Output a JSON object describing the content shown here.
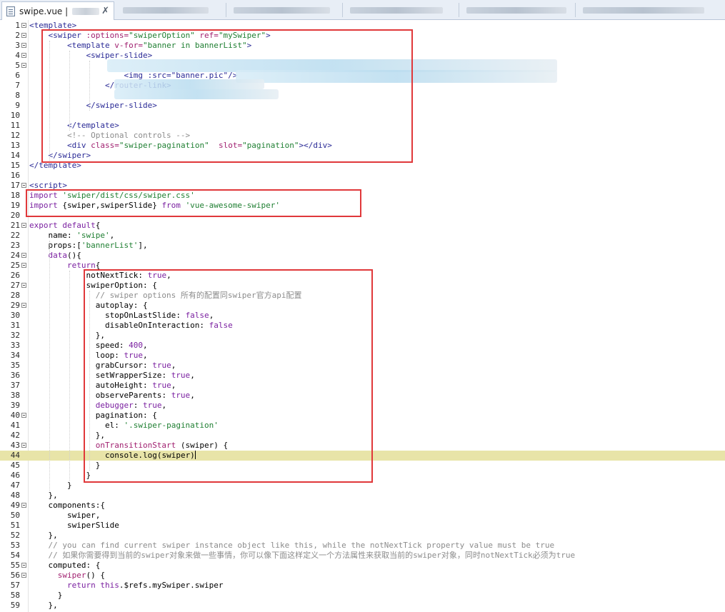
{
  "tab": {
    "filename": "swipe.vue |",
    "close": "✗"
  },
  "colors": {
    "tag": "#2a2a96",
    "attr": "#a01f6f",
    "string": "#1f7f32",
    "keyword": "#7a1fa0",
    "comment": "#8c8c8c",
    "literal": "#7a1fa0",
    "highlight_box": "#e0383a",
    "current_line": "#e8e4a8"
  },
  "lines": [
    {
      "n": "1",
      "fold": true,
      "indent": 0,
      "tokens": [
        {
          "t": "<template>",
          "c": "tag"
        }
      ]
    },
    {
      "n": "2",
      "fold": true,
      "indent": 4,
      "tokens": [
        {
          "t": "<swiper ",
          "c": "tag"
        },
        {
          "t": ":options=",
          "c": "attr"
        },
        {
          "t": "\"swiperOption\"",
          "c": "string"
        },
        {
          "t": " ref=",
          "c": "attr"
        },
        {
          "t": "\"mySwiper\"",
          "c": "string"
        },
        {
          "t": ">",
          "c": "tag"
        }
      ]
    },
    {
      "n": "3",
      "fold": true,
      "indent": 8,
      "tokens": [
        {
          "t": "<template ",
          "c": "tag"
        },
        {
          "t": "v-for=",
          "c": "attr"
        },
        {
          "t": "\"banner in bannerList\"",
          "c": "string"
        },
        {
          "t": ">",
          "c": "tag"
        }
      ]
    },
    {
      "n": "4",
      "fold": true,
      "indent": 12,
      "tokens": [
        {
          "t": "<swiper-slide>",
          "c": "tag"
        }
      ]
    },
    {
      "n": "5",
      "fold": true,
      "indent": 16,
      "tokens": []
    },
    {
      "n": "6",
      "fold": false,
      "indent": 20,
      "tokens": [
        {
          "t": "<img :src=\"banner.pic\"/>",
          "c": "tag"
        }
      ]
    },
    {
      "n": "7",
      "fold": false,
      "indent": 16,
      "tokens": [
        {
          "t": "</router-link>",
          "c": "tag"
        }
      ]
    },
    {
      "n": "8",
      "fold": false,
      "indent": 16,
      "tokens": []
    },
    {
      "n": "9",
      "fold": false,
      "indent": 12,
      "tokens": [
        {
          "t": "</swiper-slide>",
          "c": "tag"
        }
      ]
    },
    {
      "n": "10",
      "fold": false,
      "indent": 0,
      "tokens": []
    },
    {
      "n": "11",
      "fold": false,
      "indent": 8,
      "tokens": [
        {
          "t": "</template>",
          "c": "tag"
        }
      ]
    },
    {
      "n": "12",
      "fold": false,
      "indent": 8,
      "tokens": [
        {
          "t": "<!-- Optional controls -->",
          "c": "comment"
        }
      ]
    },
    {
      "n": "13",
      "fold": false,
      "indent": 8,
      "tokens": [
        {
          "t": "<div ",
          "c": "tag"
        },
        {
          "t": "class=",
          "c": "attr"
        },
        {
          "t": "\"swiper-pagination\"",
          "c": "string"
        },
        {
          "t": "  slot=",
          "c": "attr"
        },
        {
          "t": "\"pagination\"",
          "c": "string"
        },
        {
          "t": "></div>",
          "c": "tag"
        }
      ]
    },
    {
      "n": "14",
      "fold": false,
      "indent": 4,
      "tokens": [
        {
          "t": "</swiper>",
          "c": "tag"
        }
      ]
    },
    {
      "n": "15",
      "fold": false,
      "indent": 0,
      "tokens": [
        {
          "t": "</template>",
          "c": "tag"
        }
      ]
    },
    {
      "n": "16",
      "fold": false,
      "indent": 0,
      "tokens": []
    },
    {
      "n": "17",
      "fold": true,
      "indent": 0,
      "tokens": [
        {
          "t": "<script>",
          "c": "tag"
        }
      ]
    },
    {
      "n": "18",
      "fold": false,
      "indent": 0,
      "tokens": [
        {
          "t": "import ",
          "c": "keyword"
        },
        {
          "t": "'swiper/dist/css/swiper.css'",
          "c": "string"
        }
      ]
    },
    {
      "n": "19",
      "fold": false,
      "indent": 0,
      "tokens": [
        {
          "t": "import ",
          "c": "keyword"
        },
        {
          "t": "{swiper,swiperSlide} ",
          "c": "plain"
        },
        {
          "t": "from ",
          "c": "keyword"
        },
        {
          "t": "'vue-awesome-swiper'",
          "c": "string"
        }
      ]
    },
    {
      "n": "20",
      "fold": false,
      "indent": 0,
      "tokens": []
    },
    {
      "n": "21",
      "fold": true,
      "indent": 0,
      "tokens": [
        {
          "t": "export default",
          "c": "keyword"
        },
        {
          "t": "{",
          "c": "plain"
        }
      ]
    },
    {
      "n": "22",
      "fold": false,
      "indent": 4,
      "tokens": [
        {
          "t": "name",
          "c": "plain"
        },
        {
          "t": ": ",
          "c": "plain"
        },
        {
          "t": "'swipe'",
          "c": "string"
        },
        {
          "t": ",",
          "c": "plain"
        }
      ]
    },
    {
      "n": "23",
      "fold": false,
      "indent": 4,
      "tokens": [
        {
          "t": "props",
          "c": "plain"
        },
        {
          "t": ":[",
          "c": "plain"
        },
        {
          "t": "'bannerList'",
          "c": "string"
        },
        {
          "t": "],",
          "c": "plain"
        }
      ]
    },
    {
      "n": "24",
      "fold": true,
      "indent": 4,
      "tokens": [
        {
          "t": "data",
          "c": "keyword"
        },
        {
          "t": "(){",
          "c": "plain"
        }
      ]
    },
    {
      "n": "25",
      "fold": true,
      "indent": 8,
      "tokens": [
        {
          "t": "return",
          "c": "keyword"
        },
        {
          "t": "{",
          "c": "plain"
        }
      ]
    },
    {
      "n": "26",
      "fold": false,
      "indent": 12,
      "tokens": [
        {
          "t": "notNextTick",
          "c": "plain"
        },
        {
          "t": ": ",
          "c": "plain"
        },
        {
          "t": "true",
          "c": "literal"
        },
        {
          "t": ",",
          "c": "plain"
        }
      ]
    },
    {
      "n": "27",
      "fold": true,
      "indent": 12,
      "tokens": [
        {
          "t": "swiperOption",
          "c": "plain"
        },
        {
          "t": ": {",
          "c": "plain"
        }
      ]
    },
    {
      "n": "28",
      "fold": false,
      "indent": 14,
      "tokens": [
        {
          "t": "// swiper options 所有的配置同swiper官方api配置",
          "c": "comment"
        }
      ]
    },
    {
      "n": "29",
      "fold": true,
      "indent": 14,
      "tokens": [
        {
          "t": "autoplay",
          "c": "plain"
        },
        {
          "t": ": {",
          "c": "plain"
        }
      ]
    },
    {
      "n": "30",
      "fold": false,
      "indent": 16,
      "tokens": [
        {
          "t": "stopOnLastSlide",
          "c": "plain"
        },
        {
          "t": ": ",
          "c": "plain"
        },
        {
          "t": "false",
          "c": "literal"
        },
        {
          "t": ",",
          "c": "plain"
        }
      ]
    },
    {
      "n": "31",
      "fold": false,
      "indent": 16,
      "tokens": [
        {
          "t": "disableOnInteraction",
          "c": "plain"
        },
        {
          "t": ": ",
          "c": "plain"
        },
        {
          "t": "false",
          "c": "literal"
        }
      ]
    },
    {
      "n": "32",
      "fold": false,
      "indent": 14,
      "tokens": [
        {
          "t": "},",
          "c": "plain"
        }
      ]
    },
    {
      "n": "33",
      "fold": false,
      "indent": 14,
      "tokens": [
        {
          "t": "speed",
          "c": "plain"
        },
        {
          "t": ": ",
          "c": "plain"
        },
        {
          "t": "400",
          "c": "literal"
        },
        {
          "t": ",",
          "c": "plain"
        }
      ]
    },
    {
      "n": "34",
      "fold": false,
      "indent": 14,
      "tokens": [
        {
          "t": "loop",
          "c": "plain"
        },
        {
          "t": ": ",
          "c": "plain"
        },
        {
          "t": "true",
          "c": "literal"
        },
        {
          "t": ",",
          "c": "plain"
        }
      ]
    },
    {
      "n": "35",
      "fold": false,
      "indent": 14,
      "tokens": [
        {
          "t": "grabCursor",
          "c": "plain"
        },
        {
          "t": ": ",
          "c": "plain"
        },
        {
          "t": "true",
          "c": "literal"
        },
        {
          "t": ",",
          "c": "plain"
        }
      ]
    },
    {
      "n": "36",
      "fold": false,
      "indent": 14,
      "tokens": [
        {
          "t": "setWrapperSize",
          "c": "plain"
        },
        {
          "t": ": ",
          "c": "plain"
        },
        {
          "t": "true",
          "c": "literal"
        },
        {
          "t": ",",
          "c": "plain"
        }
      ]
    },
    {
      "n": "37",
      "fold": false,
      "indent": 14,
      "tokens": [
        {
          "t": "autoHeight",
          "c": "plain"
        },
        {
          "t": ": ",
          "c": "plain"
        },
        {
          "t": "true",
          "c": "literal"
        },
        {
          "t": ",",
          "c": "plain"
        }
      ]
    },
    {
      "n": "38",
      "fold": false,
      "indent": 14,
      "tokens": [
        {
          "t": "observeParents",
          "c": "plain"
        },
        {
          "t": ": ",
          "c": "plain"
        },
        {
          "t": "true",
          "c": "literal"
        },
        {
          "t": ",",
          "c": "plain"
        }
      ]
    },
    {
      "n": "39",
      "fold": false,
      "indent": 14,
      "tokens": [
        {
          "t": "debugger",
          "c": "keyword"
        },
        {
          "t": ": ",
          "c": "plain"
        },
        {
          "t": "true",
          "c": "literal"
        },
        {
          "t": ",",
          "c": "plain"
        }
      ]
    },
    {
      "n": "40",
      "fold": true,
      "indent": 14,
      "tokens": [
        {
          "t": "pagination",
          "c": "plain"
        },
        {
          "t": ": {",
          "c": "plain"
        }
      ]
    },
    {
      "n": "41",
      "fold": false,
      "indent": 16,
      "tokens": [
        {
          "t": "el",
          "c": "plain"
        },
        {
          "t": ": ",
          "c": "plain"
        },
        {
          "t": "'.swiper-pagination'",
          "c": "string"
        }
      ]
    },
    {
      "n": "42",
      "fold": false,
      "indent": 14,
      "tokens": [
        {
          "t": "},",
          "c": "plain"
        }
      ]
    },
    {
      "n": "43",
      "fold": true,
      "indent": 14,
      "tokens": [
        {
          "t": "onTransitionStart",
          "c": "attr"
        },
        {
          "t": " (swiper) {",
          "c": "plain"
        }
      ]
    },
    {
      "n": "44",
      "fold": false,
      "indent": 16,
      "current": true,
      "tokens": [
        {
          "t": "console",
          "c": "plain"
        },
        {
          "t": ".",
          "c": "plain"
        },
        {
          "t": "log",
          "c": "plain"
        },
        {
          "t": "(swiper)",
          "c": "plain"
        }
      ]
    },
    {
      "n": "45",
      "fold": false,
      "indent": 14,
      "tokens": [
        {
          "t": "}",
          "c": "plain"
        }
      ]
    },
    {
      "n": "46",
      "fold": false,
      "indent": 12,
      "tokens": [
        {
          "t": "}",
          "c": "plain"
        }
      ]
    },
    {
      "n": "47",
      "fold": false,
      "indent": 8,
      "tokens": [
        {
          "t": "}",
          "c": "plain"
        }
      ]
    },
    {
      "n": "48",
      "fold": false,
      "indent": 4,
      "tokens": [
        {
          "t": "},",
          "c": "plain"
        }
      ]
    },
    {
      "n": "49",
      "fold": true,
      "indent": 4,
      "tokens": [
        {
          "t": "components",
          "c": "plain"
        },
        {
          "t": ":{",
          "c": "plain"
        }
      ]
    },
    {
      "n": "50",
      "fold": false,
      "indent": 8,
      "tokens": [
        {
          "t": "swiper,",
          "c": "plain"
        }
      ]
    },
    {
      "n": "51",
      "fold": false,
      "indent": 8,
      "tokens": [
        {
          "t": "swiperSlide",
          "c": "plain"
        }
      ]
    },
    {
      "n": "52",
      "fold": false,
      "indent": 4,
      "tokens": [
        {
          "t": "},",
          "c": "plain"
        }
      ]
    },
    {
      "n": "53",
      "fold": false,
      "indent": 4,
      "tokens": [
        {
          "t": "// you can find current swiper instance object like this, while the notNextTick property value must be true",
          "c": "comment"
        }
      ]
    },
    {
      "n": "54",
      "fold": false,
      "indent": 4,
      "tokens": [
        {
          "t": "// 如果你需要得到当前的swiper对象来做一些事情，你可以像下面这样定义一个方法属性来获取当前的swiper对象，同时notNextTick必须为true",
          "c": "comment"
        }
      ]
    },
    {
      "n": "55",
      "fold": true,
      "indent": 4,
      "tokens": [
        {
          "t": "computed",
          "c": "plain"
        },
        {
          "t": ": {",
          "c": "plain"
        }
      ]
    },
    {
      "n": "56",
      "fold": true,
      "indent": 6,
      "tokens": [
        {
          "t": "swiper",
          "c": "attr"
        },
        {
          "t": "() {",
          "c": "plain"
        }
      ]
    },
    {
      "n": "57",
      "fold": false,
      "indent": 8,
      "tokens": [
        {
          "t": "return ",
          "c": "keyword"
        },
        {
          "t": "this",
          "c": "keyword"
        },
        {
          "t": ".$refs.mySwiper.swiper",
          "c": "plain"
        }
      ]
    },
    {
      "n": "58",
      "fold": false,
      "indent": 6,
      "tokens": [
        {
          "t": "}",
          "c": "plain"
        }
      ]
    },
    {
      "n": "59",
      "fold": false,
      "indent": 4,
      "tokens": [
        {
          "t": "},",
          "c": "plain"
        }
      ]
    }
  ]
}
